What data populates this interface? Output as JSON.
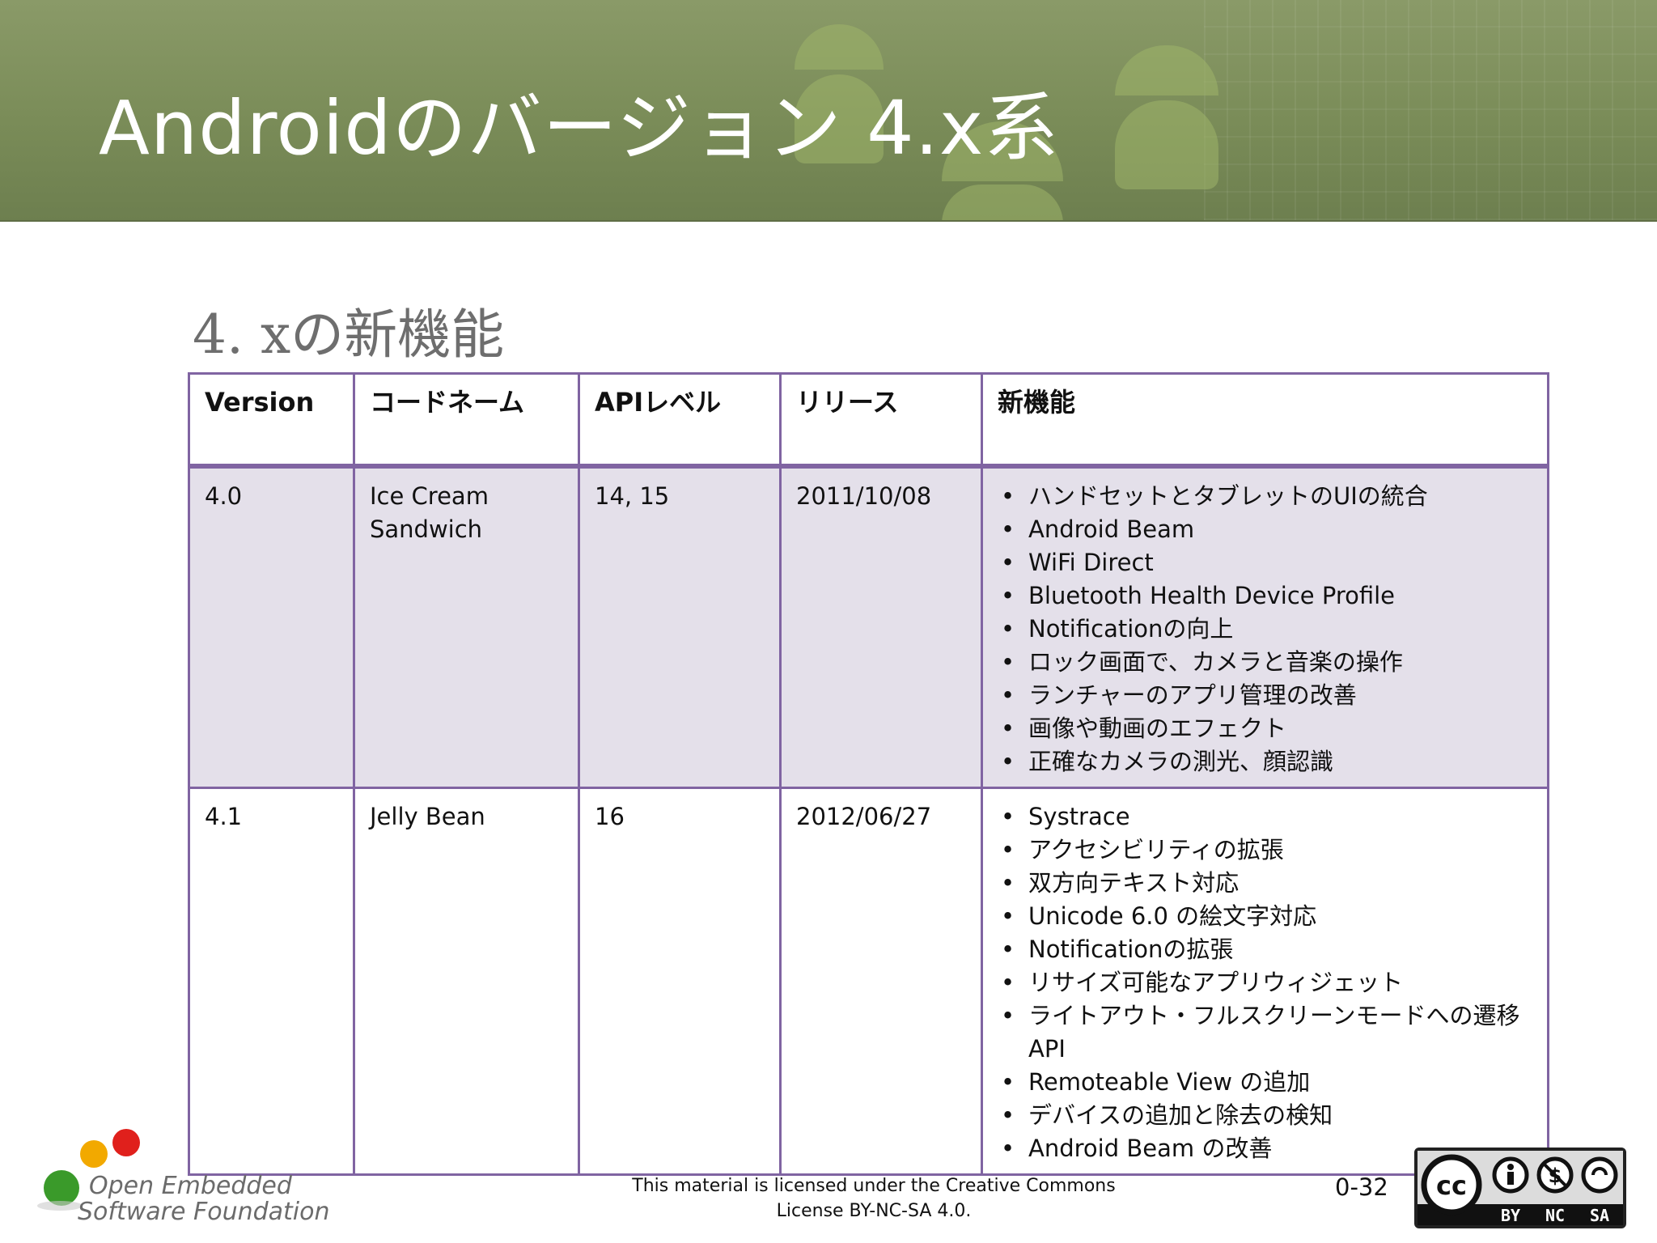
{
  "slide": {
    "title": "Androidのバージョン 4.x系",
    "subtitle": "4. xの新機能"
  },
  "table": {
    "headers": [
      "Version",
      "コードネーム",
      "APIレベル",
      "リリース",
      "新機能"
    ],
    "rows": [
      {
        "version": "4.0",
        "codename": "Ice Cream Sandwich",
        "api": "14, 15",
        "release": "2011/10/08",
        "features": [
          "ハンドセットとタブレットのUIの統合",
          "Android Beam",
          "WiFi Direct",
          "Bluetooth Health Device Profile",
          "Notificationの向上",
          "ロック画面で、カメラと音楽の操作",
          "ランチャーのアプリ管理の改善",
          "画像や動画のエフェクト",
          "正確なカメラの測光、顔認識"
        ]
      },
      {
        "version": "4.1",
        "codename": "Jelly Bean",
        "api": "16",
        "release": "2012/06/27",
        "features": [
          "Systrace",
          "アクセシビリティの拡張",
          "双方向テキスト対応",
          "Unicode 6.0 の絵文字対応",
          "Notificationの拡張",
          "リサイズ可能なアプリウィジェット",
          "ライトアウト・フルスクリーンモードへの遷移API",
          "Remoteable View の追加",
          "デバイスの追加と除去の検知",
          "Android Beam の改善"
        ]
      }
    ]
  },
  "footer": {
    "license_line1": "This material is licensed under the Creative Commons",
    "license_line2": "License BY-NC-SA 4.0.",
    "page_number": "0-32",
    "logo_line1": "Open Embedded",
    "logo_line2": "Software Foundation",
    "cc_badge_labels": [
      "BY",
      "NC",
      "SA"
    ]
  },
  "colors": {
    "banner": "#7a8c58",
    "table_border": "#8064a2",
    "row_shade": "#e4e0ea"
  }
}
